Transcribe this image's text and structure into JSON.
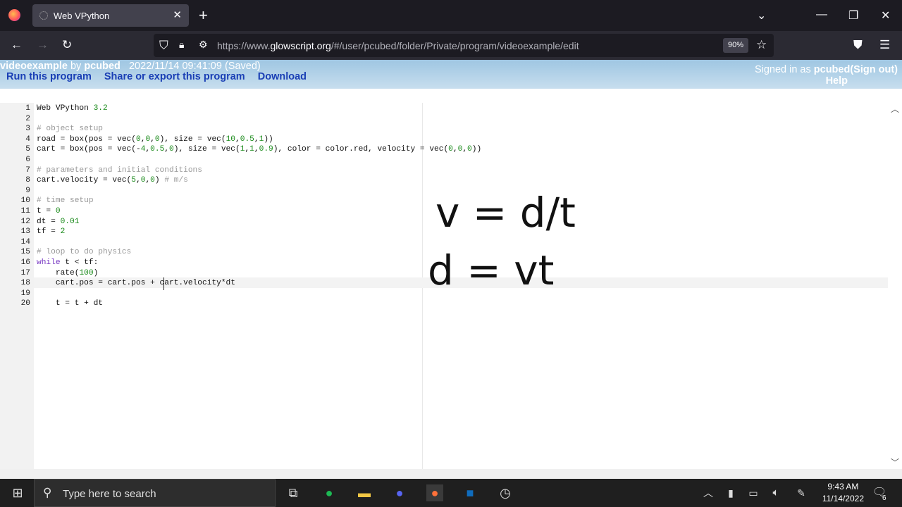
{
  "browser": {
    "tab_title": "Web VPython",
    "url_prefix": "https://www.",
    "url_domain": "glowscript.org",
    "url_path": "/#/user/pcubed/folder/Private/program/videoexample/edit",
    "zoom": "90%"
  },
  "glowscript": {
    "program_name": "videoexample",
    "by_label": "by",
    "user": "pcubed",
    "saved_status": "2022/11/14 09:41:09 (Saved)",
    "run_link": "Run this program",
    "share_link": "Share or export this program",
    "download_link": "Download",
    "signed_in_prefix": "Signed in as",
    "signed_in_user": "pcubed",
    "sign_out": "(Sign out)",
    "help": "Help"
  },
  "code_lines": [
    {
      "n": "1",
      "text": "Web VPython 3.2"
    },
    {
      "n": "2",
      "text": ""
    },
    {
      "n": "3",
      "text": "# object setup"
    },
    {
      "n": "4",
      "text": "road = box(pos = vec(0,0,0), size = vec(10,0.5,1))"
    },
    {
      "n": "5",
      "text": "cart = box(pos = vec(-4,0.5,0), size = vec(1,1,0.9), color = color.red, velocity = vec(0,0,0))"
    },
    {
      "n": "6",
      "text": ""
    },
    {
      "n": "7",
      "text": "# parameters and initial conditions"
    },
    {
      "n": "8",
      "text": "cart.velocity = vec(5,0,0) # m/s"
    },
    {
      "n": "9",
      "text": ""
    },
    {
      "n": "10",
      "text": "# time setup"
    },
    {
      "n": "11",
      "text": "t = 0"
    },
    {
      "n": "12",
      "text": "dt = 0.01"
    },
    {
      "n": "13",
      "text": "tf = 2"
    },
    {
      "n": "14",
      "text": ""
    },
    {
      "n": "15",
      "text": "# loop to do physics"
    },
    {
      "n": "16",
      "text": "while t < tf:"
    },
    {
      "n": "17",
      "text": "    rate(100)"
    },
    {
      "n": "18",
      "text": "    cart.pos = cart.pos + cart.velocity*dt"
    },
    {
      "n": "19",
      "text": ""
    },
    {
      "n": "20",
      "text": "    t = t + dt"
    }
  ],
  "overlay": {
    "formula1": "v = d/t",
    "formula2": "d = vt"
  },
  "taskbar": {
    "search_placeholder": "Type here to search",
    "time": "9:43 AM",
    "date": "11/14/2022",
    "notification_count": "6"
  },
  "colors": {
    "header_link": "#1a3fb5",
    "comment": "#999999",
    "number": "#1a8a1a"
  }
}
